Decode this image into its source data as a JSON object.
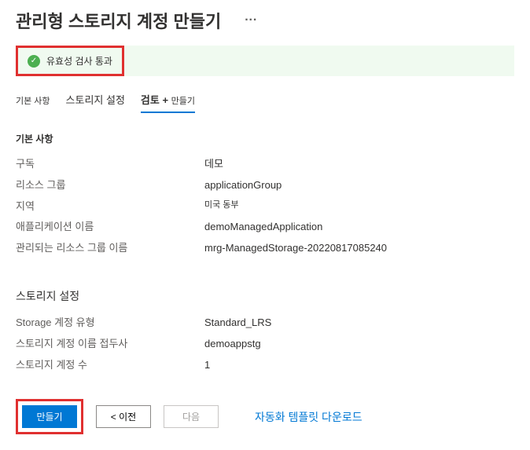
{
  "header": {
    "title": "관리형 스토리지 계정 만들기",
    "ellipsis": "···"
  },
  "validation": {
    "message": "유효성 검사 통과"
  },
  "tabs": {
    "basic": "기본 사항",
    "storage": "스토리지 설정",
    "review": "검토 +",
    "create": "만들기"
  },
  "sections": {
    "basic": {
      "heading": "기본 사항",
      "rows": [
        {
          "label": "구독",
          "value": "데모"
        },
        {
          "label": "리소스 그룹",
          "value": "applicationGroup"
        },
        {
          "label": "지역",
          "value": "미국 동부"
        },
        {
          "label": "애플리케이션 이름",
          "value": "demoManagedApplication"
        },
        {
          "label": "관리되는 리소스 그룹 이름",
          "value": "mrg-ManagedStorage-20220817085240"
        }
      ]
    },
    "storage": {
      "heading": "스토리지 설정",
      "rows": [
        {
          "label": "Storage 계정 유형",
          "value": "Standard_LRS"
        },
        {
          "label": "스토리지 계정 이름 접두사",
          "value": "demoappstg"
        },
        {
          "label": "스토리지 계정 수",
          "value": "1"
        }
      ]
    }
  },
  "footer": {
    "create": "만들기",
    "previous": "< 이전",
    "next": "다음",
    "download": "자동화 템플릿 다운로드"
  }
}
